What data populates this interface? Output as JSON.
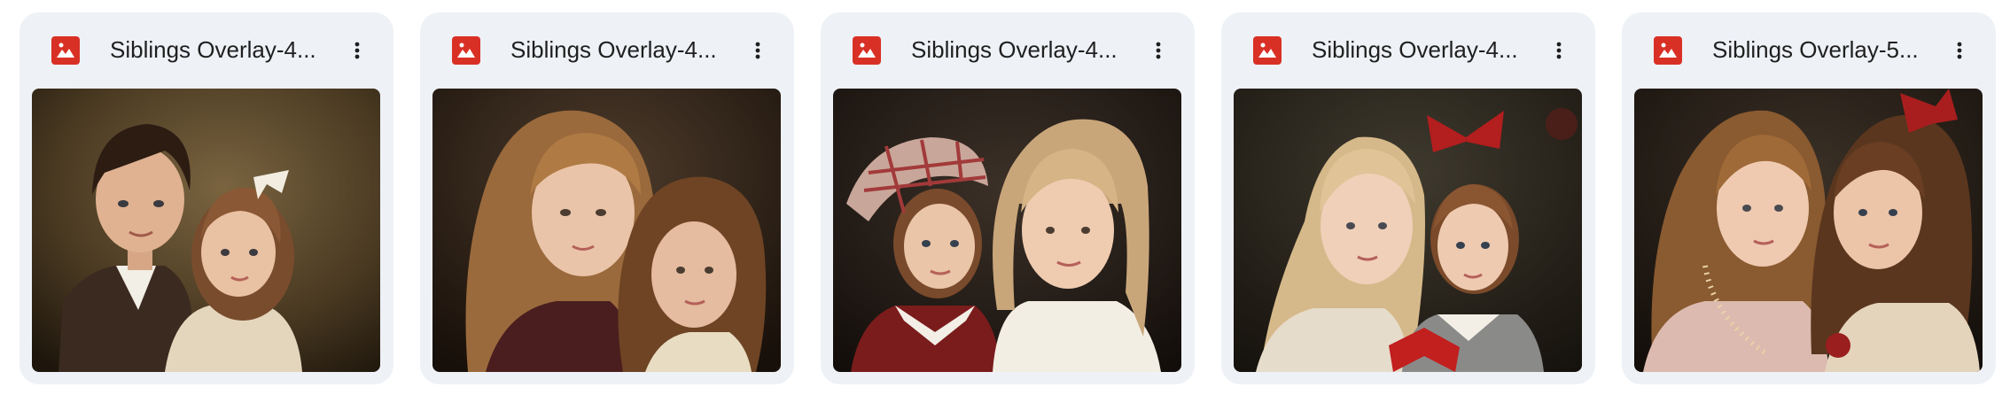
{
  "files": [
    {
      "name": "Siblings Overlay-4...",
      "icon": "image-file-icon",
      "menu_icon": "more-vert-icon",
      "thumbnail": "portrait of a dark-haired boy in a suit and a young girl with a white bow"
    },
    {
      "name": "Siblings Overlay-4...",
      "icon": "image-file-icon",
      "menu_icon": "more-vert-icon",
      "thumbnail": "portrait of two girls with long wavy light-brown hair"
    },
    {
      "name": "Siblings Overlay-4...",
      "icon": "image-file-icon",
      "menu_icon": "more-vert-icon",
      "thumbnail": "portrait of a girl in a plaid bonnet and red dress beside a blonde girl with braids"
    },
    {
      "name": "Siblings Overlay-4...",
      "icon": "image-file-icon",
      "menu_icon": "more-vert-icon",
      "thumbnail": "portrait of a blonde girl and a girl with a red bow"
    },
    {
      "name": "Siblings Overlay-5...",
      "icon": "image-file-icon",
      "menu_icon": "more-vert-icon",
      "thumbnail": "portrait of two curly-haired girls, one with a red bow"
    }
  ],
  "colors": {
    "card_background": "#eef1f6",
    "file_icon_red": "#d93025",
    "text": "#1f1f1f"
  }
}
